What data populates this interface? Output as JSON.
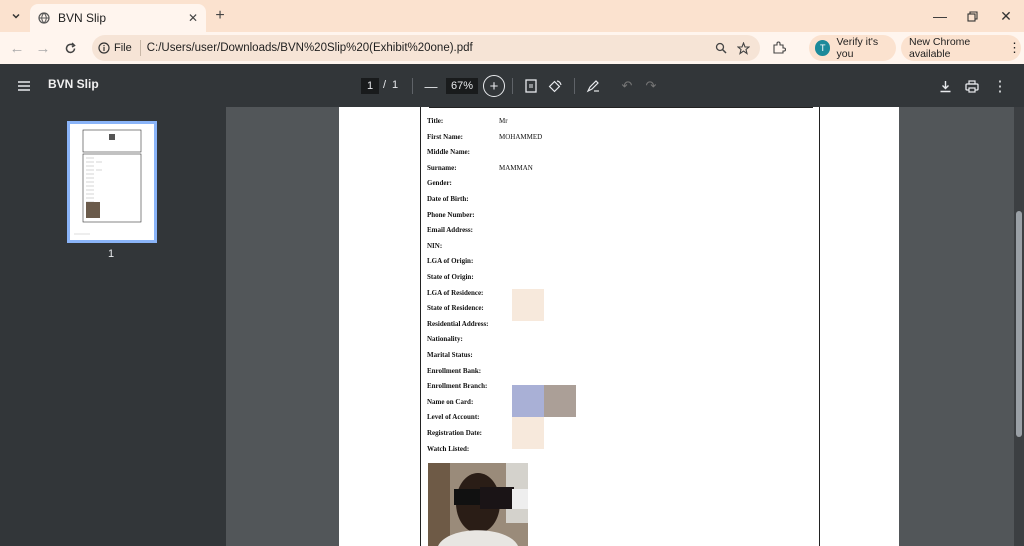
{
  "browser": {
    "tab_title": "BVN Slip",
    "url_scheme_label": "File",
    "url": "C:/Users/user/Downloads/BVN%20Slip%20(Exhibit%20one).pdf",
    "verify_label": "Verify it's you",
    "verify_avatar": "T",
    "new_chrome_label": "New Chrome available"
  },
  "pdf_toolbar": {
    "title": "BVN Slip",
    "current_page": "1",
    "page_separator": "/",
    "total_pages": "1",
    "zoom": "67%"
  },
  "thumbnail": {
    "page_number": "1"
  },
  "slip": {
    "fields": [
      {
        "label": "Title:",
        "value": "Mr"
      },
      {
        "label": "First Name:",
        "value": "MOHAMMED"
      },
      {
        "label": "Middle Name:",
        "value": ""
      },
      {
        "label": "Surname:",
        "value": "MAMMAN"
      },
      {
        "label": "Gender:",
        "value": ""
      },
      {
        "label": "Date of Birth:",
        "value": ""
      },
      {
        "label": "Phone Number:",
        "value": ""
      },
      {
        "label": "Email Address:",
        "value": ""
      },
      {
        "label": "NIN:",
        "value": ""
      },
      {
        "label": "LGA of Origin:",
        "value": ""
      },
      {
        "label": "State of Origin:",
        "value": ""
      },
      {
        "label": "LGA of Residence:",
        "value": ""
      },
      {
        "label": "State of Residence:",
        "value": ""
      },
      {
        "label": "Residential Address:",
        "value": ""
      },
      {
        "label": "Nationality:",
        "value": ""
      },
      {
        "label": "Marital Status:",
        "value": ""
      },
      {
        "label": "Enrollment Bank:",
        "value": ""
      },
      {
        "label": "Enrollment Branch:",
        "value": ""
      },
      {
        "label": "Name on Card:",
        "value": ""
      },
      {
        "label": "Level of Account:",
        "value": ""
      },
      {
        "label": "Registration Date:",
        "value": ""
      },
      {
        "label": "Watch Listed:",
        "value": ""
      }
    ]
  },
  "colors": {
    "tab_strip": "#fbe2cf",
    "pdf_toolbar": "#323639",
    "viewer_bg": "#525659",
    "thumb_highlight": "#8ab4f8"
  }
}
